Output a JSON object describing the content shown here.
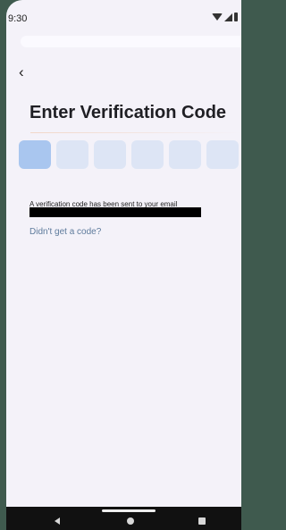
{
  "status": {
    "time": "9:30"
  },
  "header": {
    "back_icon": "chevron-left",
    "title": "Enter Verification Code"
  },
  "code_input": {
    "box_count": 6,
    "active_index": 0
  },
  "message": {
    "info": "A verification code has been sent to your email",
    "email": ""
  },
  "actions": {
    "resend": "Didn't get a code?"
  },
  "colors": {
    "background": "#f4f2f9",
    "active_box": "#a9c6ef",
    "box": "#dde5f5",
    "link": "#5e7b9c"
  }
}
